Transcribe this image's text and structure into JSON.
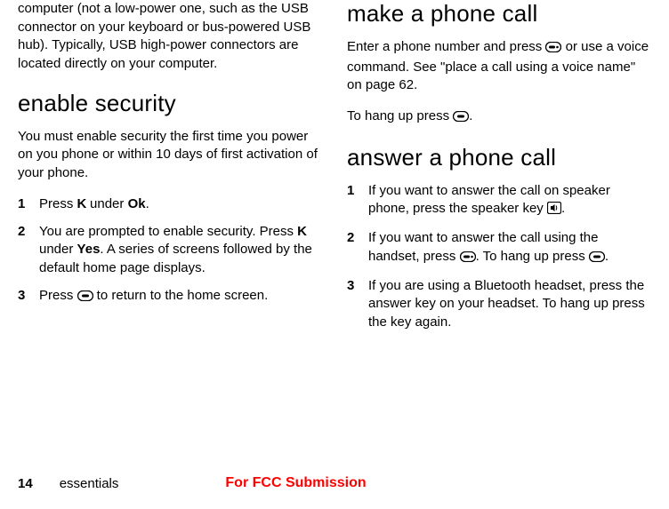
{
  "left": {
    "intro": "computer (not a low-power one, such as the USB connector on your keyboard or bus-powered USB hub). Typically, USB high-power connectors are located directly on your computer.",
    "security_heading": "enable security",
    "security_intro": "You must enable security the first time you power on you phone or within 10 days of first activation of your phone.",
    "step1_a": "Press ",
    "step1_key": "K",
    "step1_b": " under ",
    "step1_label": "Ok",
    "step1_c": ".",
    "step2_a": "You are prompted to enable security. Press ",
    "step2_key": "K",
    "step2_b": " under ",
    "step2_label": "Yes",
    "step2_c": ". A series of screens followed by the default home page displays.",
    "step3_a": "Press ",
    "step3_b": " to return to the home screen."
  },
  "right": {
    "make_heading": "make a phone call",
    "make_a": "Enter a phone number and press ",
    "make_b": " or use a voice command. See \"place a call using a voice name\" on page 62.",
    "hang_a": "To hang up press ",
    "hang_b": ".",
    "answer_heading": "answer a phone call",
    "a1_a": "If you want to answer the call on speaker phone, press the speaker key ",
    "a1_b": ".",
    "a2_a": "If you want to answer the call using the handset, press ",
    "a2_b": ". To hang up press ",
    "a2_c": ".",
    "a3": "If you are using a Bluetooth headset, press the answer key on your headset. To hang up press the key again."
  },
  "footer": {
    "page": "14",
    "section": "essentials",
    "fcc": "For FCC Submission"
  },
  "icons": {
    "pill_dot": "pill-dot-key",
    "pill": "pill-key",
    "speaker": "speaker-key"
  }
}
